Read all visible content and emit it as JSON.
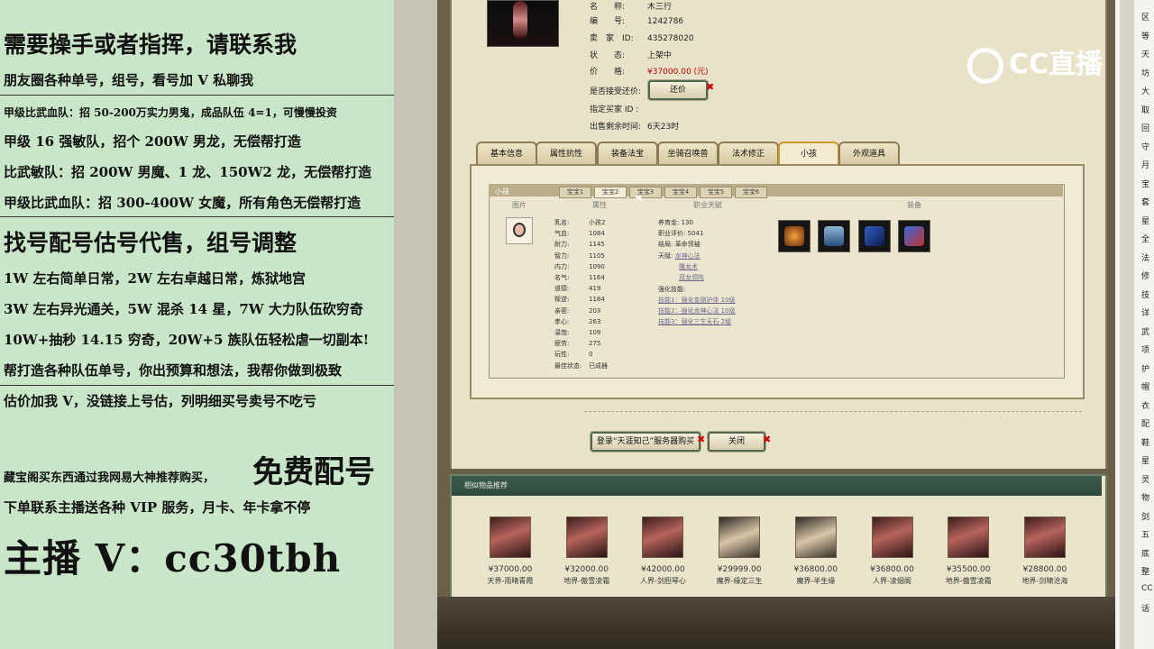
{
  "left_panel": {
    "line1": "需要操手或者指挥，请联系我",
    "line2": "朋友圈各种单号，组号，看号加 V 私聊我",
    "line3": "甲级比武血队：招 50-200万实力男鬼，成品队伍 4=1，可慢慢投资",
    "line4": "甲级 16 强敏队，招个 200W 男龙，无偿帮打造",
    "line5": "比武敏队：招 200W 男魔、1 龙、150W2 龙，无偿帮打造",
    "line6": "甲级比武血队：招 300-400W 女魔，所有角色无偿帮打造",
    "line7": "找号配号估号代售，组号调整",
    "line8": "1W 左右简单日常，2W 左右卓越日常，炼狱地宫",
    "line9": "3W 左右异光通关，5W 混杀 14 星，7W 大力队伍砍穷奇",
    "line10": "10W+抽秒 14.15 穷奇，20W+5 族队伍轻松虐一切副本!",
    "line11": "帮打造各种队伍单号，你出预算和想法，我帮你做到极致",
    "line12": "估价加我 V，没链接上号估，列明细买号卖号不吃亏",
    "line13a": "藏宝阁买东西通过我网易大神推荐购买，",
    "line13b": "免费配号",
    "line14": "下单联系主播送各种 VIP 服务，月卡、年卡拿不停",
    "line15": "主播 V：cc30tbh"
  },
  "item": {
    "name_key": "名　　称:",
    "name_val": "木三行",
    "id_key": "编　　号:",
    "id_val": "1242786",
    "seller_key": "卖　家　ID:",
    "seller_val": "435278020",
    "status_key": "状　　态:",
    "status_val": "上架中",
    "price_key": "价　　格:",
    "price_val": "¥37000.00 (元)",
    "bargain_key": "是否接受还价:",
    "bargain_btn": "还价",
    "buyer_key": "指定买家 ID :",
    "time_key": "出售剩余时间:",
    "time_val": "6天23时"
  },
  "tabs": [
    "基本信息",
    "属性抗性",
    "装备法宝",
    "坐骑召唤兽",
    "法术修正",
    "小孩",
    "外观道具"
  ],
  "child": {
    "bar_label": "小孩",
    "subtabs": [
      "宝宝1",
      "宝宝2",
      "宝宝3",
      "宝宝4",
      "宝宝5",
      "宝宝6"
    ],
    "headers": [
      "图片",
      "属性",
      "职业天赋",
      "装备"
    ],
    "attrs": [
      [
        "乳名:",
        "小孩2"
      ],
      [
        "气血:",
        "1084"
      ],
      [
        "耐力:",
        "1145"
      ],
      [
        "智力:",
        "1105"
      ],
      [
        "内力:",
        "1090"
      ],
      [
        "名气:",
        "1164"
      ],
      [
        "道德:",
        "419"
      ],
      [
        "叛逆:",
        "1184"
      ],
      [
        "亲密:",
        "203"
      ],
      [
        "孝心:",
        "263"
      ],
      [
        "温饱:",
        "109"
      ],
      [
        "疲劳:",
        "275"
      ],
      [
        "玩性:",
        "0"
      ],
      [
        "最佳状态:",
        "已成器"
      ]
    ],
    "prof": {
      "gold_k": "养育金:",
      "gold_v": "130",
      "eval_k": "职业评价:",
      "eval_v": "5041",
      "end_k": "结局:",
      "end_v": "革命领袖",
      "talent_k": "天赋:",
      "talent1": "龙神心法",
      "talent2": "雕龙术",
      "talent3": "双龙领阵",
      "skill_k": "强化技能:",
      "skill1": "技能1：强化金刚护体 10级",
      "skill2": "技能2：强化龙神心法 10级",
      "skill3": "技能3：强化三生无石 2级"
    }
  },
  "buttons": {
    "login": "登录“天涯知己”服务器购买",
    "close": "关闭"
  },
  "recommend": {
    "title": "相似物品推荐",
    "items": [
      {
        "price": "¥37000.00",
        "name": "天界-雨晴青霞"
      },
      {
        "price": "¥32000.00",
        "name": "地界-傲雪凌霜"
      },
      {
        "price": "¥42000.00",
        "name": "人界-剑胆琴心"
      },
      {
        "price": "¥29999.00",
        "name": "魔界-缘定三生"
      },
      {
        "price": "¥36800.00",
        "name": "魔界-半生缘"
      },
      {
        "price": "¥36800.00",
        "name": "人界-凌烟阁"
      },
      {
        "price": "¥35500.00",
        "name": "地界-傲雪凌霜"
      },
      {
        "price": "¥28800.00",
        "name": "地界-剑啸沧海"
      }
    ]
  },
  "logo": "CC直播",
  "right_sidebar": [
    "区",
    "等",
    "天",
    "坊",
    "大",
    "取",
    "回",
    "守",
    "月",
    "宝",
    "套",
    "星",
    "全",
    "法",
    "修",
    "技",
    "详",
    "武",
    "项",
    "护",
    "帽",
    "衣",
    "配",
    "鞋",
    "星",
    "灵",
    "物",
    "剑",
    "五",
    "底",
    "整",
    "CC",
    "话"
  ]
}
